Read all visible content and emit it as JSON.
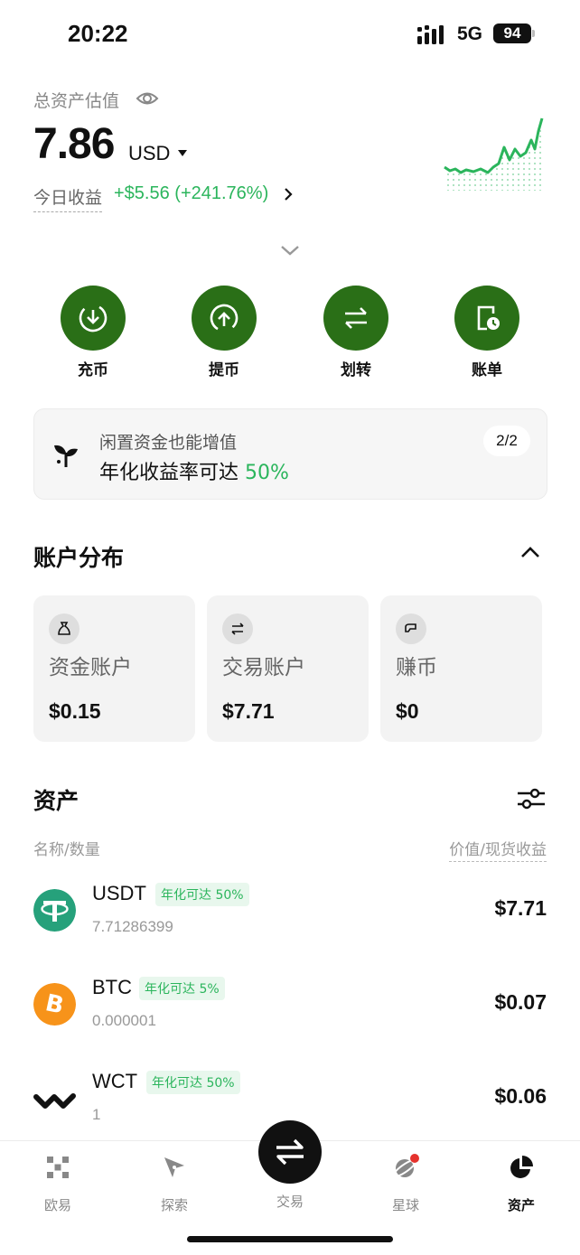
{
  "status": {
    "time": "20:22",
    "network": "5G",
    "battery": "94"
  },
  "summary": {
    "label": "总资产估值",
    "value": "7.86",
    "currency": "USD",
    "today_label": "今日收益",
    "today_value": "+$5.56 (+241.76%)"
  },
  "actions": [
    {
      "label": "充币",
      "icon": "deposit-icon"
    },
    {
      "label": "提币",
      "icon": "withdraw-icon"
    },
    {
      "label": "划转",
      "icon": "transfer-icon"
    },
    {
      "label": "账单",
      "icon": "bill-icon"
    }
  ],
  "promo": {
    "line1": "闲置资金也能增值",
    "line2_prefix": "年化收益率可达 ",
    "line2_highlight": "50%",
    "page": "2/2"
  },
  "accounts": {
    "title": "账户分布",
    "items": [
      {
        "name": "资金账户",
        "value": "$0.15"
      },
      {
        "name": "交易账户",
        "value": "$7.71"
      },
      {
        "name": "赚币",
        "value": "$0"
      }
    ]
  },
  "assets": {
    "title": "资产",
    "col_left": "名称/数量",
    "col_right": "价值/现货收益",
    "items": [
      {
        "symbol": "USDT",
        "badge": "年化可达 50%",
        "amount": "7.71286399",
        "value": "$7.71",
        "color": "#26a17b"
      },
      {
        "symbol": "BTC",
        "badge": "年化可达 5%",
        "amount": "0.000001",
        "value": "$0.07",
        "color": "#f7931a"
      },
      {
        "symbol": "WCT",
        "badge": "年化可达 50%",
        "amount": "1",
        "value": "$0.06",
        "color": "#111111"
      }
    ]
  },
  "tabs": [
    {
      "label": "欧易"
    },
    {
      "label": "探索"
    },
    {
      "label": "交易"
    },
    {
      "label": "星球"
    },
    {
      "label": "资产"
    }
  ],
  "colors": {
    "accent_green": "#2bb55c",
    "action_green": "#2a6f17"
  }
}
